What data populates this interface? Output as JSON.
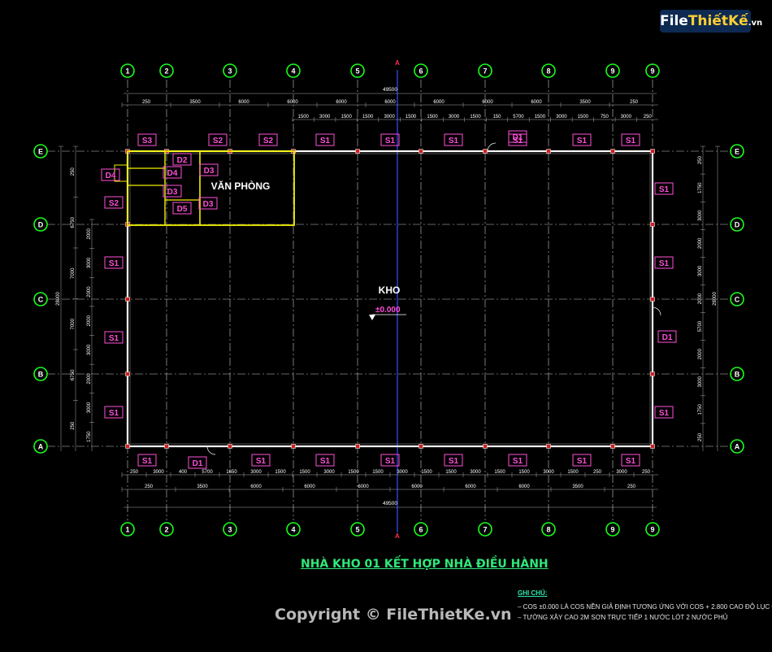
{
  "logo": {
    "file": "File",
    "rest": "ThiếtKế",
    "dotvn": ".vn"
  },
  "grid_cols": [
    "1",
    "2",
    "3",
    "4",
    "5",
    "6",
    "7",
    "8",
    "9"
  ],
  "grid_rows": [
    "E",
    "D",
    "C",
    "B",
    "A"
  ],
  "section_mark": "A",
  "dims": {
    "top_total": "49500",
    "top_row1": [
      "250",
      "3500",
      "6000",
      "6000",
      "6000",
      "6000",
      "6000",
      "6000",
      "6000",
      "3500",
      "250"
    ],
    "top_row2": [
      "1500",
      "3000",
      "1500",
      "1500",
      "3000",
      "1500",
      "1500",
      "3000",
      "1500",
      "150",
      "5700",
      "1500",
      "3000",
      "1500",
      "750",
      "3000",
      "250"
    ],
    "bottom_row1": [
      "250",
      "3000",
      "400",
      "5700",
      "1650",
      "3000",
      "1500",
      "1500",
      "3000",
      "1500",
      "1500",
      "3000",
      "1500",
      "1500",
      "3000",
      "1500",
      "1500",
      "3000",
      "1500",
      "250",
      "3000",
      "250"
    ],
    "bottom_row2": [
      "250",
      "3500",
      "6000",
      "6000",
      "6000",
      "6000",
      "6000",
      "6000",
      "3500",
      "250"
    ],
    "bottom_total": "49500",
    "left_outer": "28000",
    "left_inner": [
      "250",
      "6750",
      "7000",
      "7000",
      "6750",
      "250"
    ],
    "left_small": [
      "2000",
      "3000",
      "2000",
      "2000",
      "3000",
      "2000",
      "3000",
      "1750"
    ],
    "right_outer": "28000",
    "right_inner": [
      "250",
      "1750",
      "3000",
      "2000",
      "3000",
      "2000",
      "5700",
      "2000",
      "3000",
      "1750",
      "250"
    ]
  },
  "windows": {
    "top": [
      "S3",
      "S2",
      "S2",
      "S1",
      "S1",
      "S1",
      "S1",
      "S1"
    ],
    "bottom": [
      "S1",
      "S1",
      "S1",
      "S1",
      "S1",
      "S1",
      "S1",
      "S1"
    ],
    "left": [
      "S2",
      "S1",
      "S1",
      "S1"
    ],
    "right": [
      "S1",
      "S1",
      "S1"
    ],
    "doors": [
      "D1",
      "D2",
      "D3",
      "D3",
      "D3",
      "D4",
      "D4",
      "D5",
      "D1",
      "D1",
      "D6"
    ]
  },
  "rooms": {
    "office": "VĂN PHÒNG",
    "warehouse": "KHO",
    "level": "±0.000"
  },
  "title": "NHÀ KHO 01 KẾT HỢP NHÀ ĐIỀU HÀNH",
  "notes": {
    "heading": "GHI CHÚ:",
    "line1": "– COS ±0.000 LÀ COS NỀN GIẢ ĐỊNH TƯƠNG ỨNG VỚI COS + 2.800 CAO ĐỘ LỤC ĐỊA",
    "line2": "– TƯỜNG XÂY CAO 2M SƠN TRỰC TIẾP 1 NƯỚC LÓT 2 NƯỚC PHỦ"
  },
  "copyright": "Copyright © FileThietKe.vn",
  "colors": {
    "grid": "#c8c8c8",
    "wall": "#ffffff",
    "office": "#f0f000",
    "bubble": "#19ff19",
    "tag": "#ff4fd8",
    "dim": "#3aa0ff",
    "section": "#3050ff"
  }
}
